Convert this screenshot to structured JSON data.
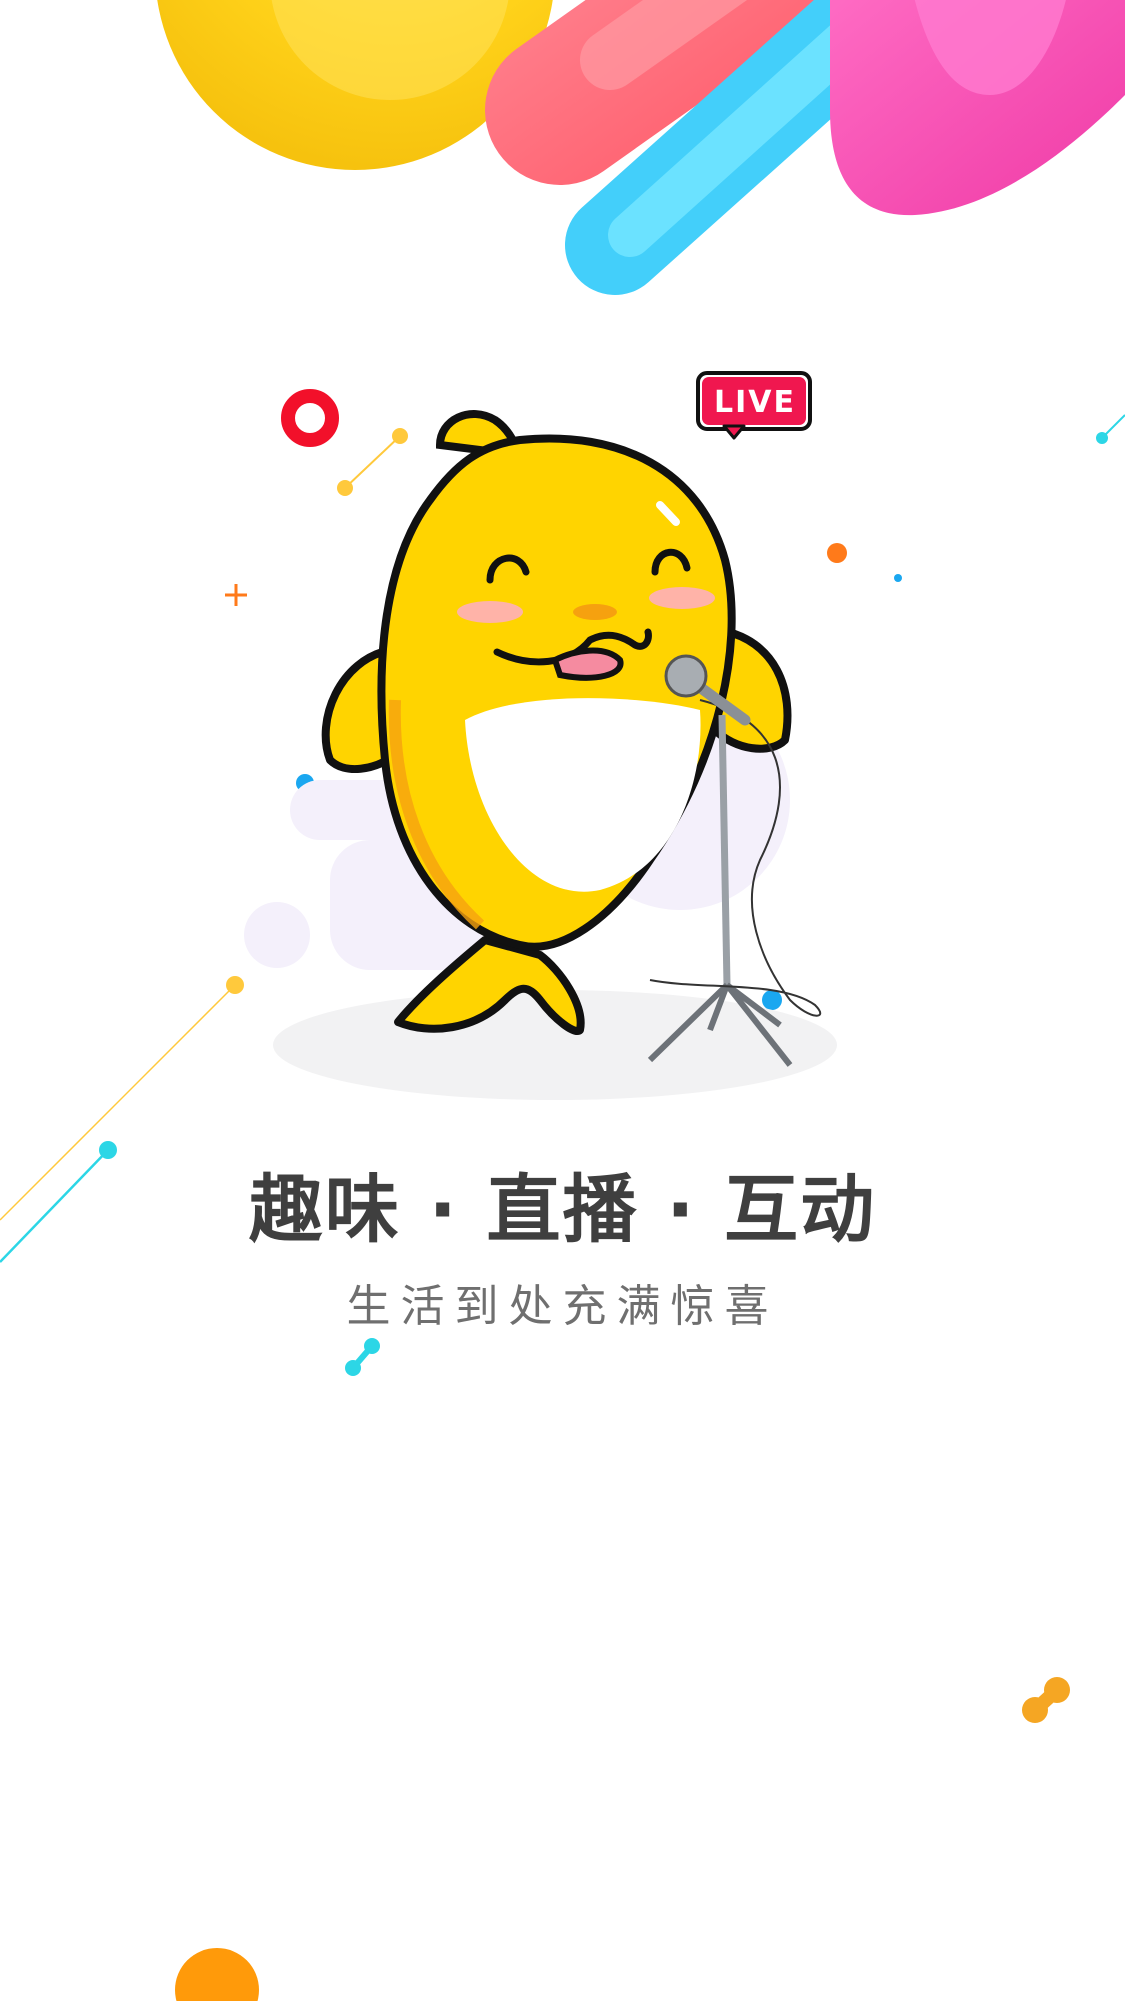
{
  "splash": {
    "live_badge": "LIVE",
    "headline": "趣味 · 直播 · 互动",
    "tagline": "生活到处充满惊喜"
  },
  "colors": {
    "yellow": "#FFD400",
    "coral": "#FF6F7A",
    "cyan": "#4FD8FF",
    "magenta": "#F347B0",
    "live_red": "#F0174F",
    "orange": "#FF9A0A",
    "text_dark": "#3f3f3f",
    "text_gray": "#6f6f6f"
  },
  "icons": {
    "mascot": "singing-dolphin-mascot",
    "microphone": "microphone-stand-icon",
    "live": "live-badge-icon"
  }
}
